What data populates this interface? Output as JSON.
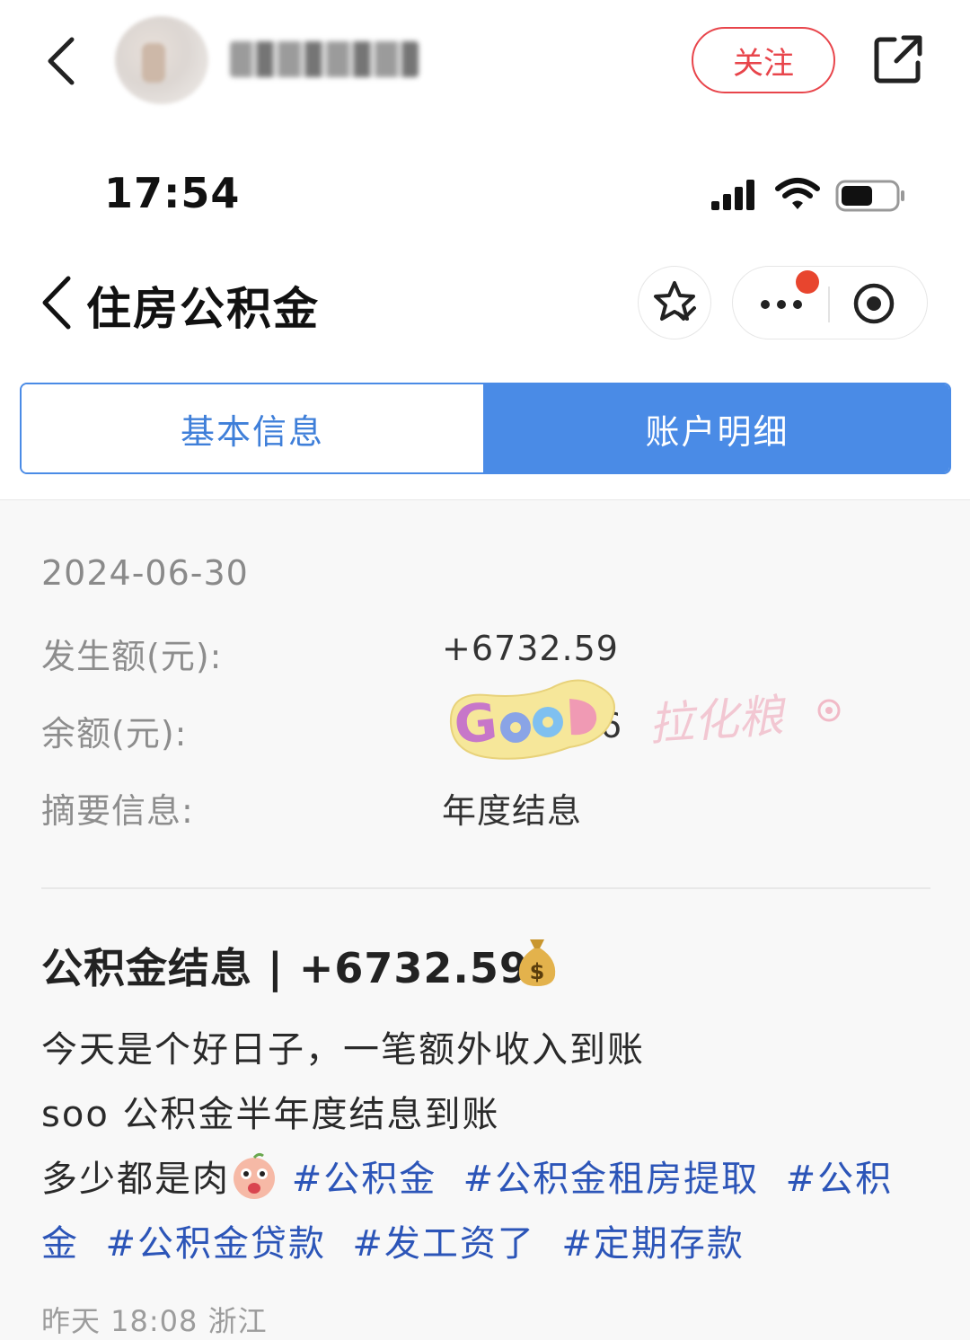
{
  "post_header": {
    "follow_label": "关注"
  },
  "status_bar": {
    "time": "17:54"
  },
  "mini_program": {
    "title": "住房公积金"
  },
  "tabs": [
    {
      "label": "基本信息",
      "active": false
    },
    {
      "label": "账户明细",
      "active": true
    }
  ],
  "record": {
    "date": "2024-06-30",
    "amount_label": "发生额(元):",
    "amount_value": "+6732.59",
    "balance_label": "余额(元):",
    "balance_value_partial": "6",
    "summary_label": "摘要信息:",
    "summary_value": "年度结息"
  },
  "sticker": {
    "text": "GOOD"
  },
  "watermark": {
    "text": "拉化粮"
  },
  "post": {
    "title": "公积金结息 | +6732.59",
    "line1": "今天是个好日子，一笔额外收入到账",
    "line2": "soo 公积金半年度结息到账",
    "line3_text": "多少都是肉",
    "tags": [
      "#公积金",
      "#公积金租房提取",
      "#公积",
      "金",
      "#公积金贷款",
      "#发工资了",
      "#定期存款"
    ],
    "meta": "昨天 18:08 浙江"
  },
  "colors": {
    "accent_blue": "#4a8be6",
    "follow_red": "#e8454b",
    "tag_blue": "#2c55b8",
    "notification_dot": "#e8452e"
  },
  "icons": [
    "back-icon",
    "share-icon",
    "signal-icon",
    "wifi-icon",
    "battery-icon",
    "star-icon",
    "more-icon",
    "close-mp-icon",
    "moneybag-icon"
  ]
}
